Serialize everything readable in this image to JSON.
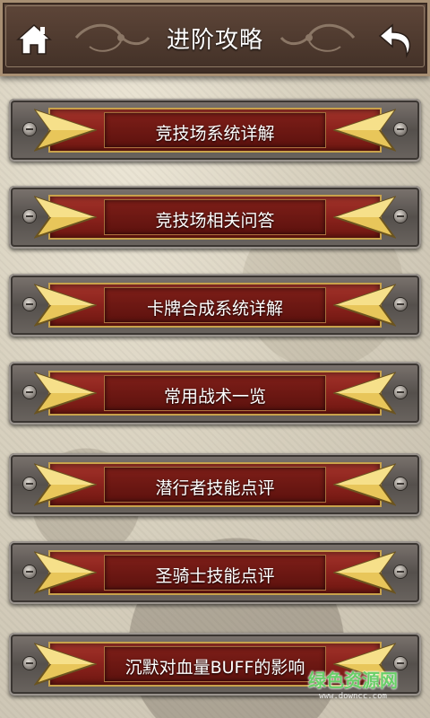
{
  "header": {
    "title": "进阶攻略",
    "home_icon": "home-icon",
    "back_icon": "back-arrow-icon"
  },
  "menu": {
    "items": [
      {
        "label": "竞技场系统详解"
      },
      {
        "label": "竞技场相关问答"
      },
      {
        "label": "卡牌合成系统详解"
      },
      {
        "label": "常用战术一览"
      },
      {
        "label": "潜行者技能点评"
      },
      {
        "label": "圣骑士技能点评"
      },
      {
        "label": "沉默对血量BUFF的影响"
      }
    ]
  },
  "watermark": {
    "text": "绿色资源网",
    "sub": "www.downcc.com"
  },
  "colors": {
    "header_bg": "#4e3a30",
    "plate_red": "#8a221c",
    "gold": "#e8c65a",
    "text": "#ffffff"
  }
}
